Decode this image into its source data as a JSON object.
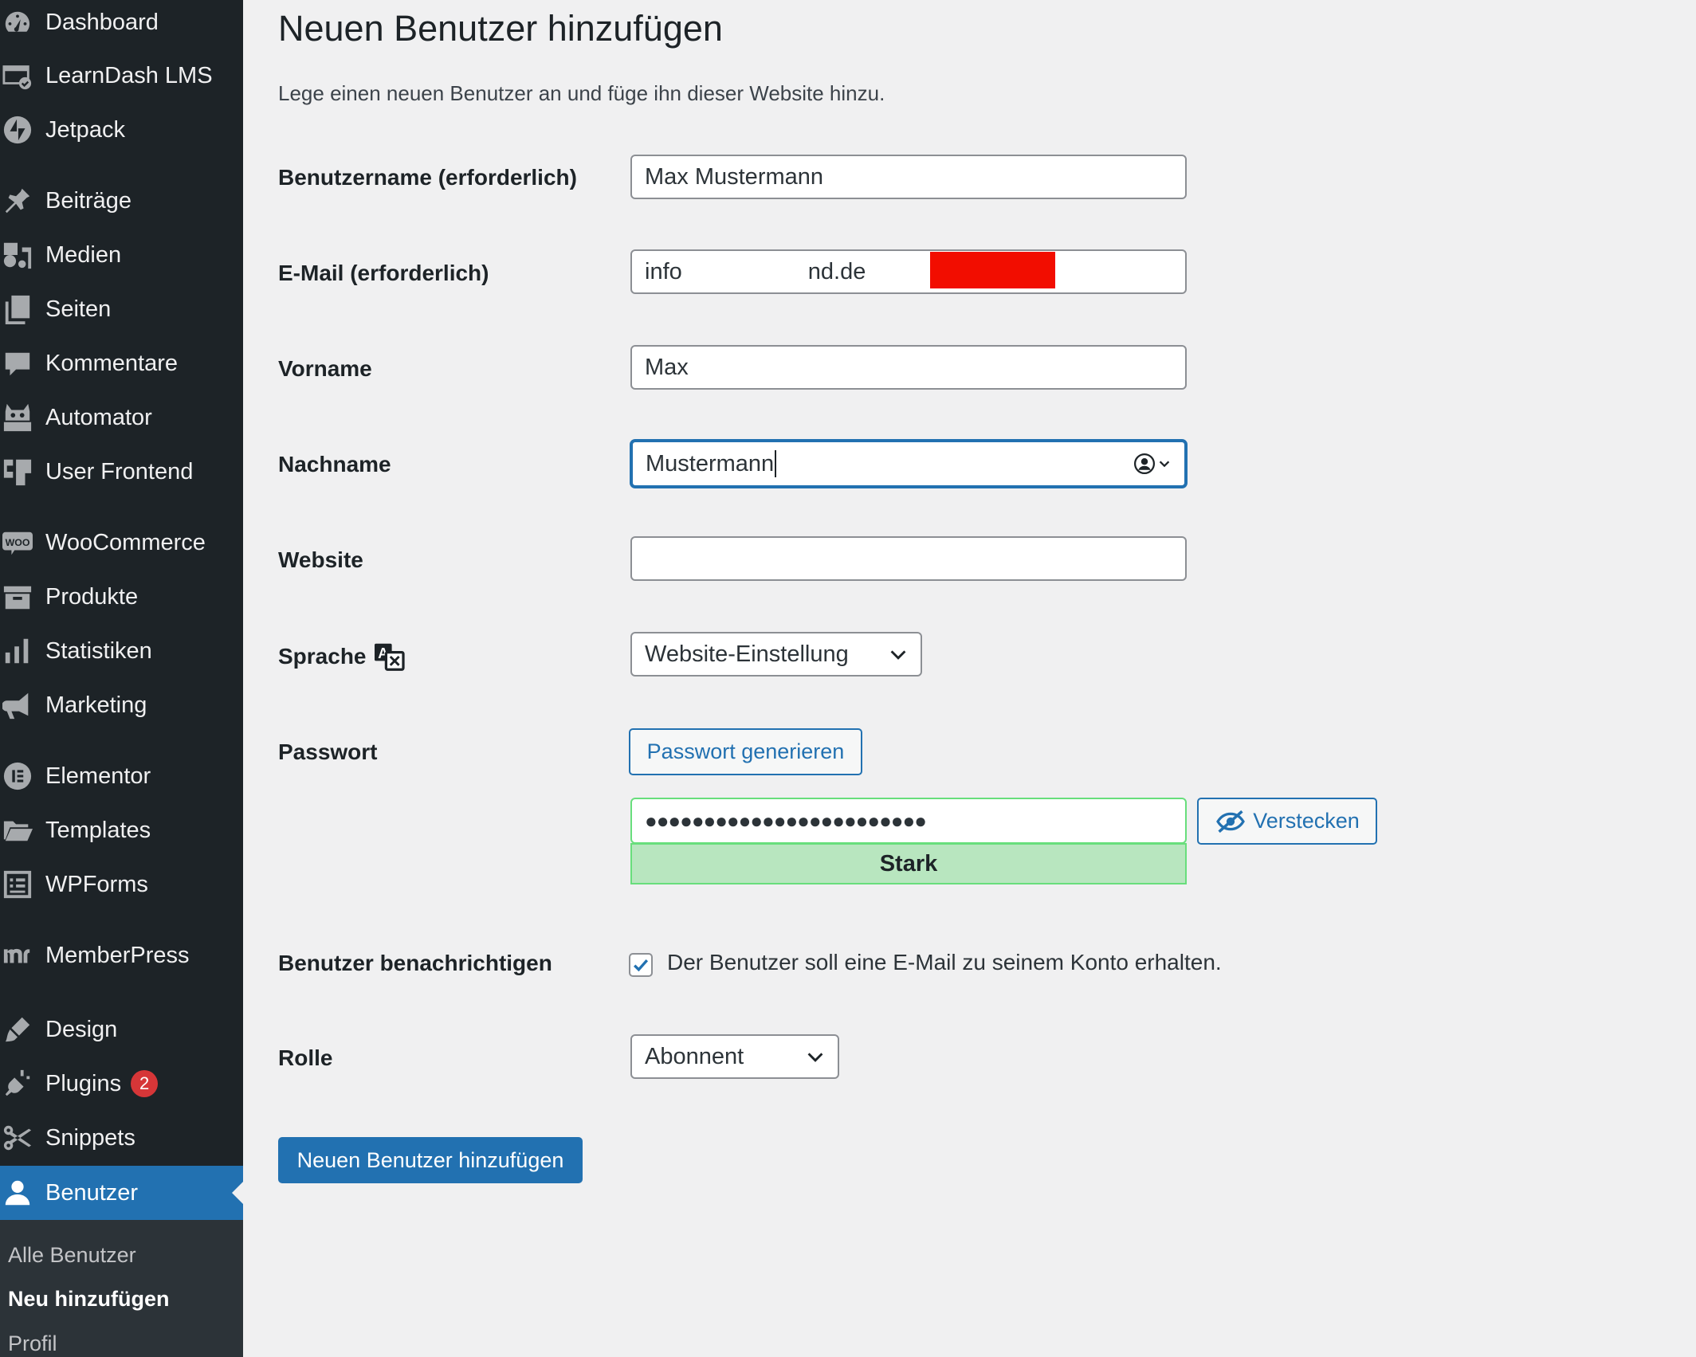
{
  "sidebar": {
    "items": [
      {
        "label": "Dashboard",
        "icon": "dashboard-icon"
      },
      {
        "label": "LearnDash LMS",
        "icon": "learndash-icon"
      },
      {
        "label": "Jetpack",
        "icon": "jetpack-icon"
      },
      {
        "label": "Beiträge",
        "icon": "pin-icon"
      },
      {
        "label": "Medien",
        "icon": "media-icon"
      },
      {
        "label": "Seiten",
        "icon": "pages-icon"
      },
      {
        "label": "Kommentare",
        "icon": "comments-icon"
      },
      {
        "label": "Automator",
        "icon": "robot-icon"
      },
      {
        "label": "User Frontend",
        "icon": "user-frontend-icon"
      },
      {
        "label": "WooCommerce",
        "icon": "woo-icon"
      },
      {
        "label": "Produkte",
        "icon": "archive-icon"
      },
      {
        "label": "Statistiken",
        "icon": "chart-bar-icon"
      },
      {
        "label": "Marketing",
        "icon": "megaphone-icon"
      },
      {
        "label": "Elementor",
        "icon": "elementor-icon"
      },
      {
        "label": "Templates",
        "icon": "folder-icon"
      },
      {
        "label": "WPForms",
        "icon": "form-icon"
      },
      {
        "label": "MemberPress",
        "icon": "memberpress-icon"
      },
      {
        "label": "Design",
        "icon": "brush-icon"
      },
      {
        "label": "Plugins",
        "icon": "plug-icon",
        "badge": "2"
      },
      {
        "label": "Snippets",
        "icon": "scissors-icon"
      },
      {
        "label": "Benutzer",
        "icon": "user-icon",
        "active": true
      }
    ],
    "submenu": [
      {
        "label": "Alle Benutzer"
      },
      {
        "label": "Neu hinzufügen",
        "current": true
      },
      {
        "label": "Profil"
      }
    ]
  },
  "page": {
    "title": "Neuen Benutzer hinzufügen",
    "intro": "Lege einen neuen Benutzer an und füge ihn dieser Website hinzu."
  },
  "form": {
    "username_label": "Benutzername (erforderlich)",
    "username_value": "Max Mustermann",
    "email_label": "E-Mail (erforderlich)",
    "email_value_start": "info",
    "email_value_end": "nd.de",
    "firstname_label": "Vorname",
    "firstname_value": "Max",
    "lastname_label": "Nachname",
    "lastname_value": "Mustermann",
    "website_label": "Website",
    "website_value": "",
    "language_label": "Sprache",
    "language_value": "Website-Einstellung",
    "password_label": "Passwort",
    "generate_password": "Passwort generieren",
    "password_mask": "●●●●●●●●●●●●●●●●●●●●●●●●",
    "hide_label": "Verstecken",
    "strength": "Stark",
    "notify_label": "Benutzer benachrichtigen",
    "notify_text": "Der Benutzer soll eine E-Mail zu seinem Konto erhalten.",
    "notify_checked": true,
    "role_label": "Rolle",
    "role_value": "Abonnent",
    "submit": "Neuen Benutzer hinzufügen"
  },
  "colors": {
    "sidebar_bg": "#1d2327",
    "accent": "#2271b1",
    "badge": "#d63638",
    "strength_bg": "#b8e6bf",
    "redaction": "#f20d00"
  }
}
